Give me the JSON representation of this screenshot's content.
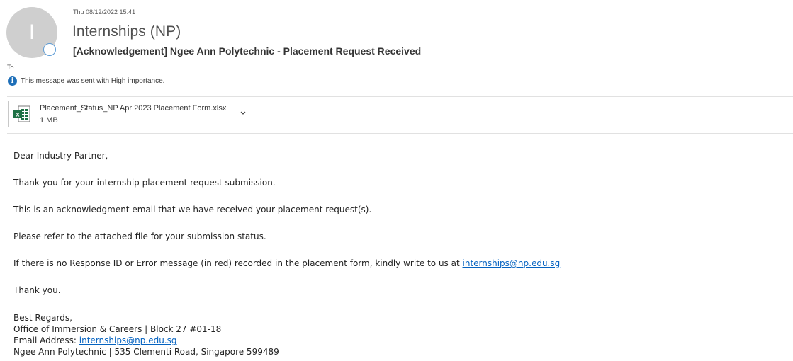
{
  "header": {
    "date": "Thu 08/12/2022 15:41",
    "avatar_letter": "I",
    "sender": "Internships (NP)",
    "subject": "[Acknowledgement] Ngee Ann Polytechnic - Placement Request Received",
    "to_label": "To",
    "importance_text": "This message was sent with High importance."
  },
  "attachment": {
    "file_name": "Placement_Status_NP Apr 2023 Placement Form.xlsx",
    "file_size": "1 MB",
    "icon": "excel-file-icon"
  },
  "body": {
    "greeting": "Dear Industry Partner,",
    "para1": "Thank you for your internship placement request submission.",
    "para2": "This is an acknowledgment email that we have received your placement request(s).",
    "para3": "Please refer to the attached file for your submission status.",
    "para4_text": "If there is no Response ID or Error message (in red) recorded in the placement form, kindly write to us at ",
    "para4_link": "internships@np.edu.sg",
    "thanks": "Thank you.",
    "signature": {
      "line1": "Best Regards,",
      "line2": "Office of Immersion & Careers | Block 27 #01-18",
      "line3_label": "Email Address: ",
      "line3_link": "internships@np.edu.sg",
      "line4": "Ngee Ann Polytechnic | 535 Clementi Road, Singapore 599489"
    }
  },
  "colors": {
    "link": "#0563c1",
    "info_icon": "#1e6fb8",
    "excel_green": "#1e7145",
    "avatar_bg": "#cfcfcf"
  }
}
